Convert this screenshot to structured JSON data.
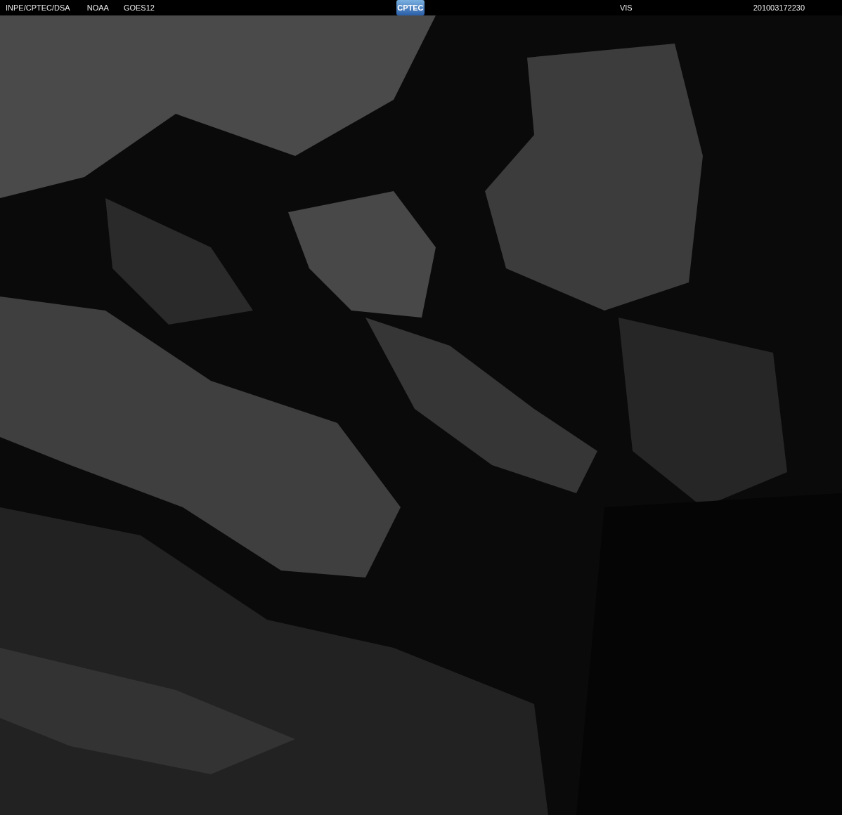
{
  "header": {
    "source": "INPE/CPTEC/DSA",
    "agency": "NOAA",
    "satellite": "GOES12",
    "logo": "CPTEC",
    "channel": "VIS",
    "timestamp": "201003172230"
  }
}
